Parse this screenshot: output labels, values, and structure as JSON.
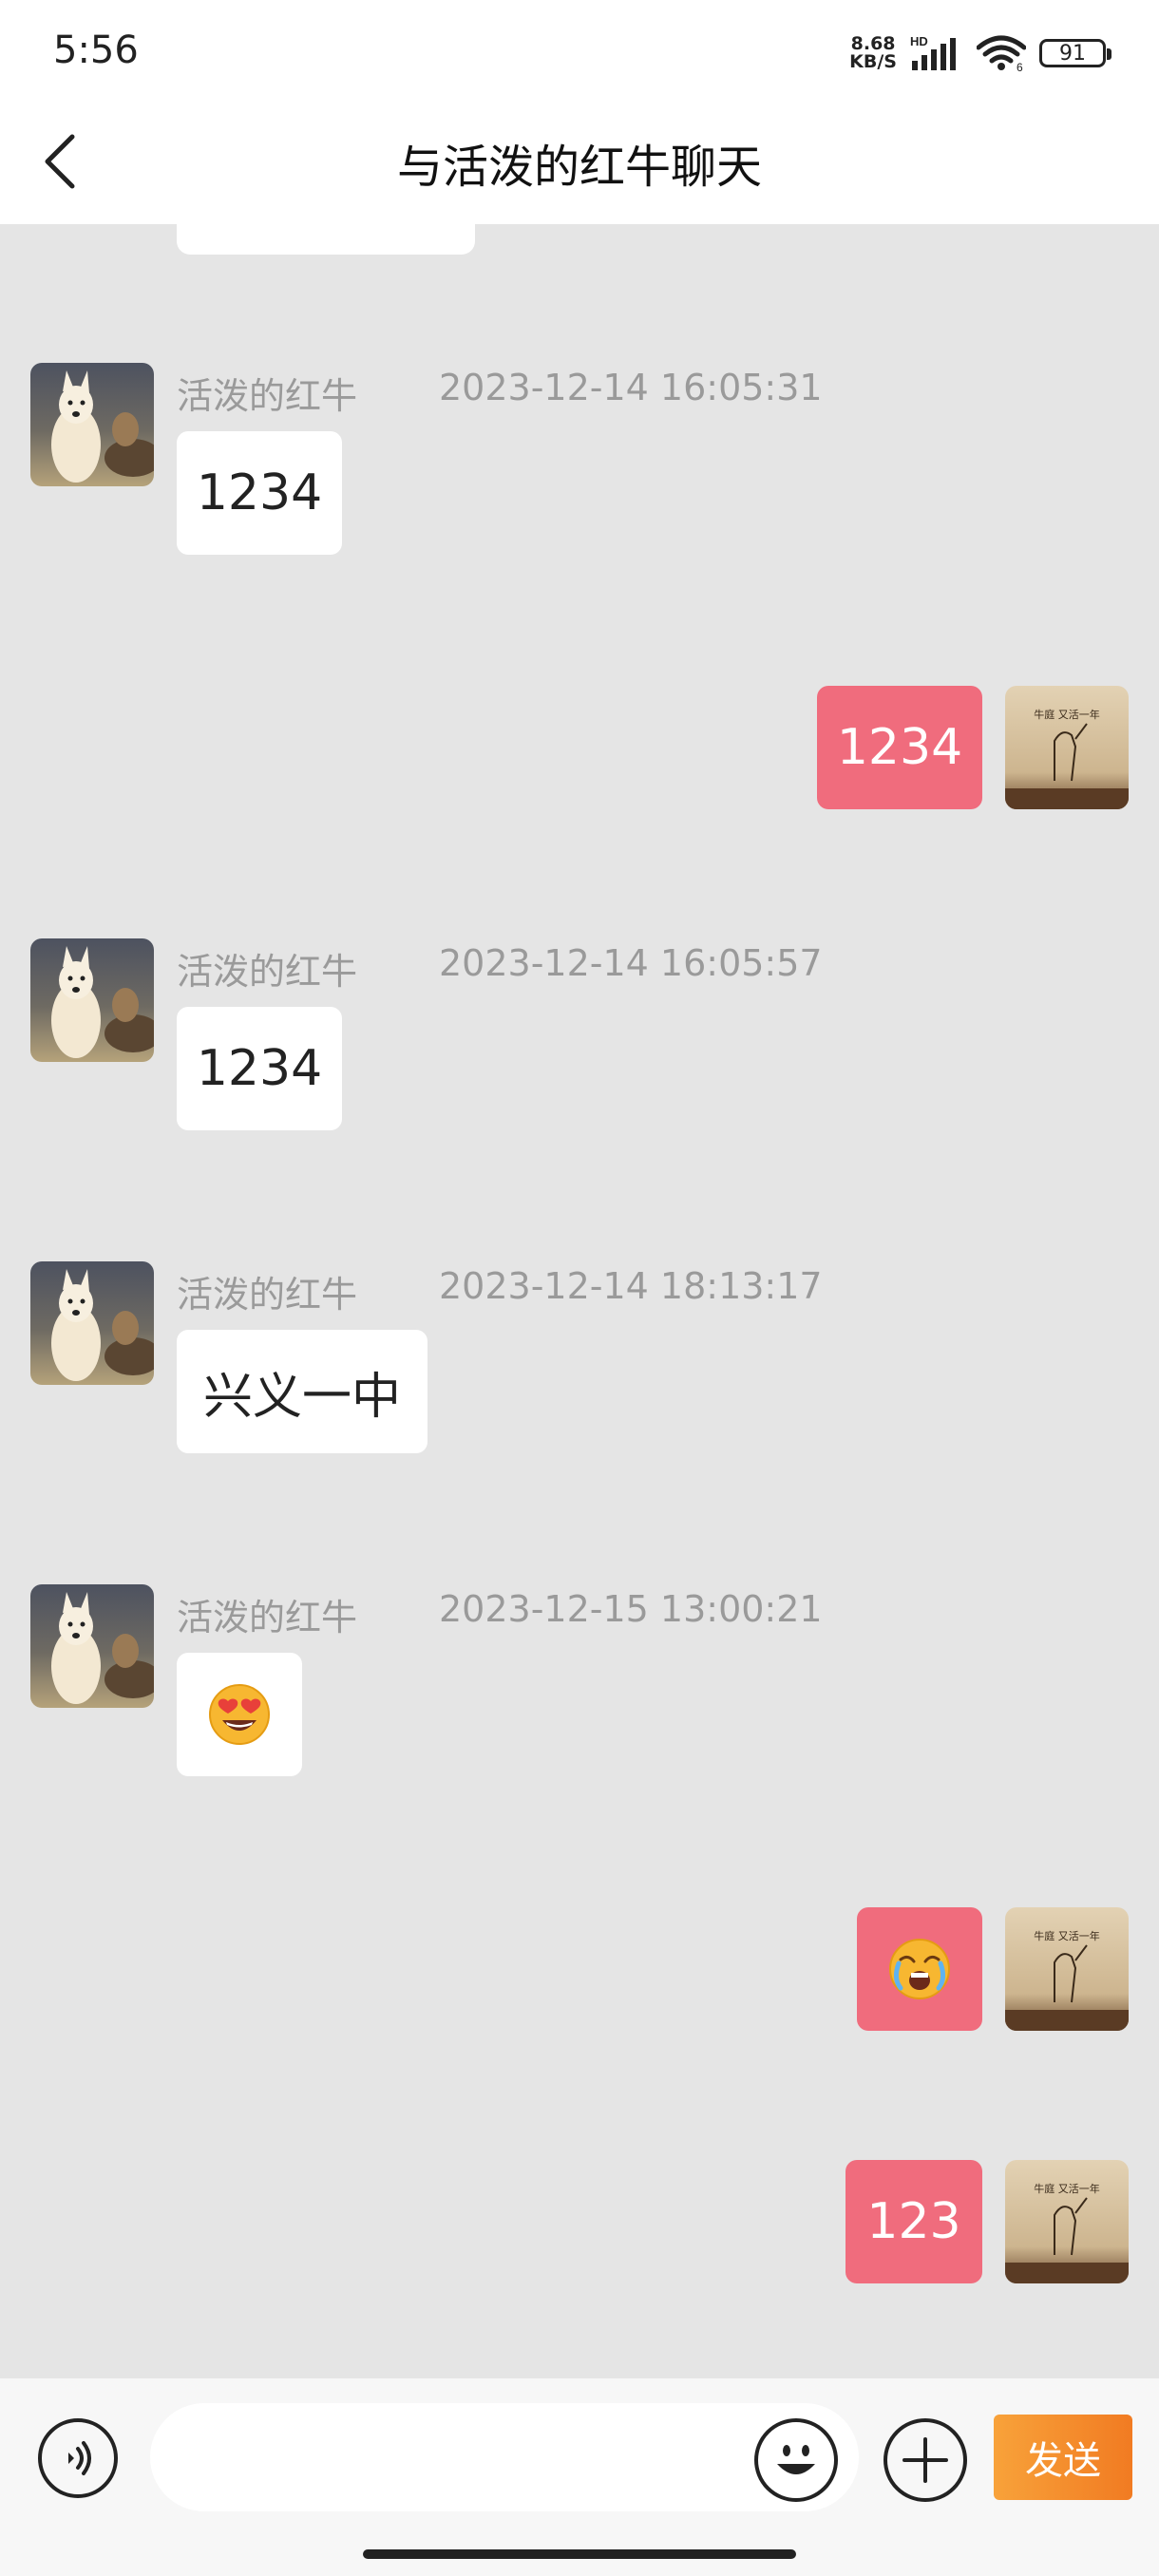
{
  "status_bar": {
    "time": "5:56",
    "net_speed_value": "8.68",
    "net_speed_unit": "KB/S",
    "network_type": "HD",
    "wifi_badge": "6",
    "battery": "91"
  },
  "header": {
    "title": "与活泼的红牛聊天",
    "back_icon": "chevron-left-icon"
  },
  "messages": [
    {
      "direction": "in",
      "sender": "活泼的红牛",
      "timestamp": "2023-12-14 16:05:31",
      "text": "1234"
    },
    {
      "direction": "out",
      "text": "1234"
    },
    {
      "direction": "in",
      "sender": "活泼的红牛",
      "timestamp": "2023-12-14 16:05:57",
      "text": "1234"
    },
    {
      "direction": "in",
      "sender": "活泼的红牛",
      "timestamp": "2023-12-14 18:13:17",
      "text": "兴义一中"
    },
    {
      "direction": "in",
      "sender": "活泼的红牛",
      "timestamp": "2023-12-15 13:00:21",
      "emoji": "heart-eyes-emoji"
    },
    {
      "direction": "out",
      "emoji": "crying-emoji"
    },
    {
      "direction": "out",
      "text": "123"
    }
  ],
  "my_avatar_caption": "牛庭 又活一年",
  "input_bar": {
    "voice_icon": "voice-icon",
    "input_value": "",
    "emoji_icon": "smile-icon",
    "plus_icon": "plus-icon",
    "send_label": "发送"
  },
  "colors": {
    "background": "#e5e5e5",
    "incoming_bubble": "#ffffff",
    "outgoing_bubble": "#f06c7d",
    "send_button": "#f38a2c"
  }
}
